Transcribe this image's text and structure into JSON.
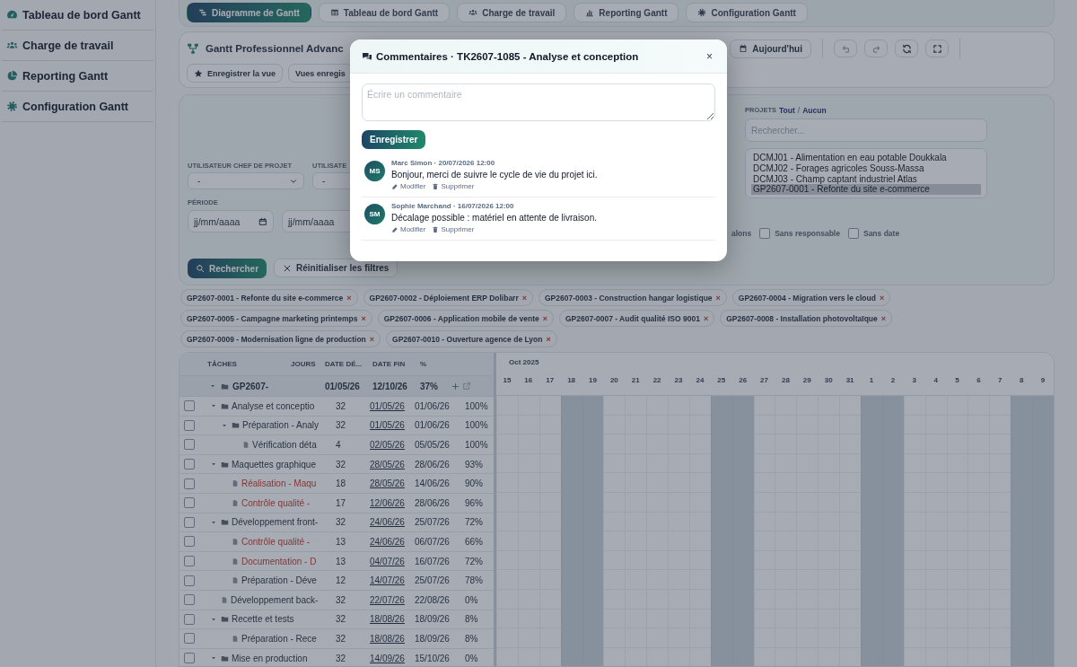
{
  "sidebar": {
    "items": [
      {
        "label": "Tableau de bord Gantt"
      },
      {
        "label": "Charge de travail"
      },
      {
        "label": "Reporting Gantt"
      },
      {
        "label": "Configuration Gantt"
      }
    ]
  },
  "tabs": [
    {
      "label": "Diagramme de Gantt",
      "selected": true
    },
    {
      "label": "Tableau de bord Gantt",
      "selected": false
    },
    {
      "label": "Charge de travail",
      "selected": false
    },
    {
      "label": "Reporting Gantt",
      "selected": false
    },
    {
      "label": "Configuration Gantt",
      "selected": false
    }
  ],
  "toolbar": {
    "title": "Gantt Professionnel Advanc",
    "actions": [
      "Enregistrer la vue",
      "Vues enregis"
    ],
    "today": "Aujourd'hui"
  },
  "filters": {
    "selects": [
      {
        "label": "UTILISATEUR CHEF DE PROJET",
        "value": "-"
      },
      {
        "label": "UTILISATE",
        "value": "-"
      }
    ],
    "period": {
      "label": "PÉRIODE",
      "dates": [
        {
          "placeholder": "jj/mm/aaaa"
        },
        {
          "placeholder": "jj/mm/aaaa"
        }
      ]
    },
    "projects": {
      "label": "PROJETS",
      "all": "Tout",
      "separator": "/",
      "none": "Aucun",
      "search": {
        "placeholder": "Rechercher..."
      },
      "options": [
        {
          "label": "DCMJ01 - Alimentation en eau potable Doukkala",
          "selected": false
        },
        {
          "label": "DCMJ02 - Forages agricoles Souss-Massa",
          "selected": false
        },
        {
          "label": "DCMJ03 - Champ captant industriel Atlas",
          "selected": false
        },
        {
          "label": "GP2607-0001 - Refonte du site e-commerce",
          "selected": true
        }
      ]
    },
    "checkboxes": [
      {
        "label": "alons"
      },
      {
        "label": "Sans responsable",
        "checked": false
      },
      {
        "label": "Sans date",
        "checked": false
      }
    ],
    "search_button": "Rechercher",
    "reset_button": "Réinitialiser les filtres"
  },
  "chips": [
    {
      "label": "GP2607-0001 - Refonte du site e-commerce",
      "remove": "×"
    },
    {
      "label": "GP2607-0002 - Déploiement ERP Dolibarr",
      "remove": "×"
    },
    {
      "label": "GP2607-0003 - Construction hangar logistique",
      "remove": "×"
    },
    {
      "label": "GP2607-0004 - Migration vers le cloud",
      "remove": "×"
    },
    {
      "label": "GP2607-0005 - Campagne marketing printemps",
      "remove": "×"
    },
    {
      "label": "GP2607-0006 - Application mobile de vente",
      "remove": "×"
    },
    {
      "label": "GP2607-0007 - Audit qualité ISO 9001",
      "remove": "×"
    },
    {
      "label": "GP2607-0008 - Installation photovoltaïque",
      "remove": "×"
    },
    {
      "label": "GP2607-0009 - Modernisation ligne de production",
      "remove": "×"
    },
    {
      "label": "GP2607-0010 - Ouverture agence de Lyon",
      "remove": "×"
    }
  ],
  "gantt": {
    "columns": [
      "TÂCHES",
      "JOURS",
      "DATE DÉ...",
      "DATE FIN",
      "%"
    ],
    "group": {
      "name": "GP2607-",
      "start": "01/05/26",
      "end": "12/10/26",
      "progress": "37%",
      "expanded": true
    },
    "rows": [
      {
        "kind": "folder",
        "name": "Analyse et conceptio",
        "days": "32",
        "start": "01/05/26",
        "end": "01/06/26",
        "progress": "100%",
        "late": false,
        "checked": false,
        "expanded": true,
        "children": [
          {
            "kind": "folder",
            "name": "Préparation - Analy",
            "days": "32",
            "start": "01/05/26",
            "end": "01/06/26",
            "progress": "100%",
            "late": false,
            "checked": false,
            "expanded": true,
            "children": [
              {
                "kind": "task",
                "name": "Vérification déta",
                "days": "4",
                "start": "02/05/26",
                "end": "05/05/26",
                "progress": "100%",
                "late": false,
                "checked": false
              }
            ]
          }
        ]
      },
      {
        "kind": "folder",
        "name": "Maquettes graphique",
        "days": "32",
        "start": "28/05/26",
        "end": "28/06/26",
        "progress": "93%",
        "late": false,
        "checked": false,
        "expanded": true,
        "children": [
          {
            "kind": "task",
            "name": "Réalisation - Maqu",
            "days": "18",
            "start": "28/05/26",
            "end": "14/06/26",
            "progress": "90%",
            "late": true,
            "checked": false
          },
          {
            "kind": "task",
            "name": "Contrôle qualité -",
            "days": "17",
            "start": "12/06/26",
            "end": "28/06/26",
            "progress": "96%",
            "late": true,
            "checked": false
          }
        ]
      },
      {
        "kind": "folder",
        "name": "Développement front-",
        "days": "32",
        "start": "24/06/26",
        "end": "25/07/26",
        "progress": "72%",
        "late": false,
        "checked": false,
        "expanded": true,
        "children": [
          {
            "kind": "task",
            "name": "Contrôle qualité -",
            "days": "13",
            "start": "24/06/26",
            "end": "06/07/26",
            "progress": "66%",
            "late": true,
            "checked": false
          },
          {
            "kind": "task",
            "name": "Documentation - D",
            "days": "13",
            "start": "04/07/26",
            "end": "16/07/26",
            "progress": "72%",
            "late": true,
            "checked": false
          },
          {
            "kind": "task",
            "name": "Préparation - Déve",
            "days": "12",
            "start": "14/07/26",
            "end": "25/07/26",
            "progress": "78%",
            "late": false,
            "checked": false
          }
        ]
      },
      {
        "kind": "task",
        "name": "Développement back-",
        "days": "32",
        "start": "22/07/26",
        "end": "22/08/26",
        "progress": "0%",
        "late": false,
        "checked": false
      },
      {
        "kind": "folder",
        "name": "Recette et tests",
        "days": "32",
        "start": "18/08/26",
        "end": "18/09/26",
        "progress": "8%",
        "late": false,
        "checked": false,
        "expanded": true,
        "children": [
          {
            "kind": "task",
            "name": "Préparation - Rece",
            "days": "32",
            "start": "18/08/26",
            "end": "18/09/26",
            "progress": "8%",
            "late": false,
            "checked": false
          }
        ]
      },
      {
        "kind": "folder",
        "name": "Mise en production",
        "days": "32",
        "start": "14/09/26",
        "end": "15/10/26",
        "progress": "0%",
        "late": false,
        "checked": false,
        "expanded": true
      }
    ],
    "timeline": {
      "month": "Oct 2025",
      "days": [
        {
          "label": "15",
          "weekend": false
        },
        {
          "label": "16",
          "weekend": false
        },
        {
          "label": "17",
          "weekend": false
        },
        {
          "label": "18",
          "weekend": true
        },
        {
          "label": "19",
          "weekend": true
        },
        {
          "label": "20",
          "weekend": false
        },
        {
          "label": "21",
          "weekend": false
        },
        {
          "label": "22",
          "weekend": false
        },
        {
          "label": "23",
          "weekend": false
        },
        {
          "label": "24",
          "weekend": false
        },
        {
          "label": "25",
          "weekend": true
        },
        {
          "label": "26",
          "weekend": true
        },
        {
          "label": "27",
          "weekend": false
        },
        {
          "label": "28",
          "weekend": false
        },
        {
          "label": "29",
          "weekend": false
        },
        {
          "label": "30",
          "weekend": false
        },
        {
          "label": "31",
          "weekend": false
        },
        {
          "label": "1",
          "weekend": true
        },
        {
          "label": "2",
          "weekend": true
        },
        {
          "label": "3",
          "weekend": false
        },
        {
          "label": "4",
          "weekend": false
        },
        {
          "label": "5",
          "weekend": false
        },
        {
          "label": "6",
          "weekend": false
        },
        {
          "label": "7",
          "weekend": false
        },
        {
          "label": "8",
          "weekend": true
        },
        {
          "label": "9",
          "weekend": true
        }
      ]
    }
  },
  "modal": {
    "title": "Commentaires · TK2607-1085 - Analyse et conception",
    "close": "×",
    "comment": {
      "placeholder": "Écrire un commentaire"
    },
    "save": "Enregistrer",
    "comments": [
      {
        "initials": "MS",
        "meta": "Marc Simon · 20/07/2026 12:00",
        "text": "Bonjour, merci de suivre le cycle de vie du projet ici.",
        "actions": [
          "Modifier",
          "Supprimer"
        ]
      },
      {
        "initials": "SM",
        "meta": "Sophie Marchand · 16/07/2026 12:00",
        "text": "Décalage possible : matériel en attente de livraison.",
        "actions": [
          "Modifier",
          "Supprimer"
        ]
      }
    ]
  }
}
